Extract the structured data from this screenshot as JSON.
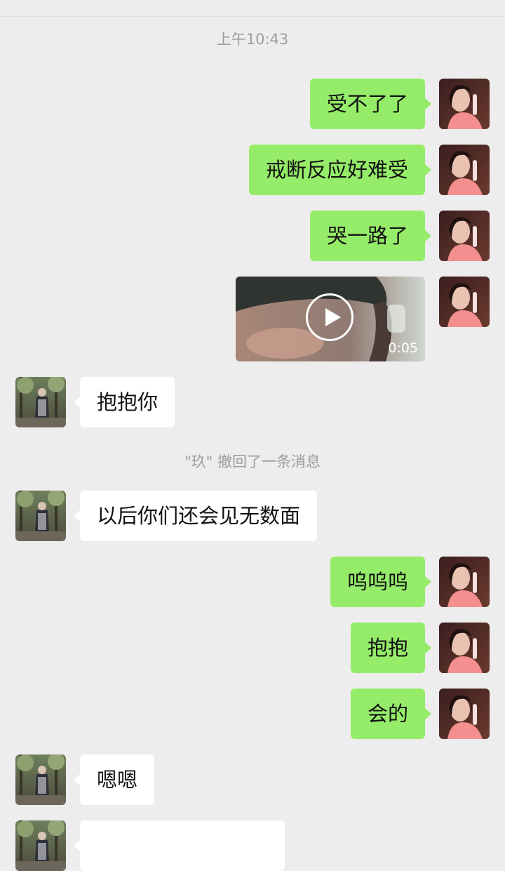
{
  "timestamp": "上午10:43",
  "recall_notice": "\"玖\" 撤回了一条消息",
  "video": {
    "duration": "0:05"
  },
  "messages": [
    {
      "from": "me",
      "text": "受不了了"
    },
    {
      "from": "me",
      "text": "戒断反应好难受"
    },
    {
      "from": "me",
      "text": "哭一路了"
    },
    {
      "from": "me",
      "type": "video"
    },
    {
      "from": "other",
      "text": "抱抱你"
    },
    {
      "from": "other",
      "text": "以后你们还会见无数面"
    },
    {
      "from": "me",
      "text": "呜呜呜"
    },
    {
      "from": "me",
      "text": "抱抱"
    },
    {
      "from": "me",
      "text": "会的"
    },
    {
      "from": "other",
      "text": "嗯嗯"
    }
  ],
  "colors": {
    "background": "#ededed",
    "my_bubble": "#95ec69",
    "their_bubble": "#ffffff",
    "system_text": "#9d9d9d"
  }
}
